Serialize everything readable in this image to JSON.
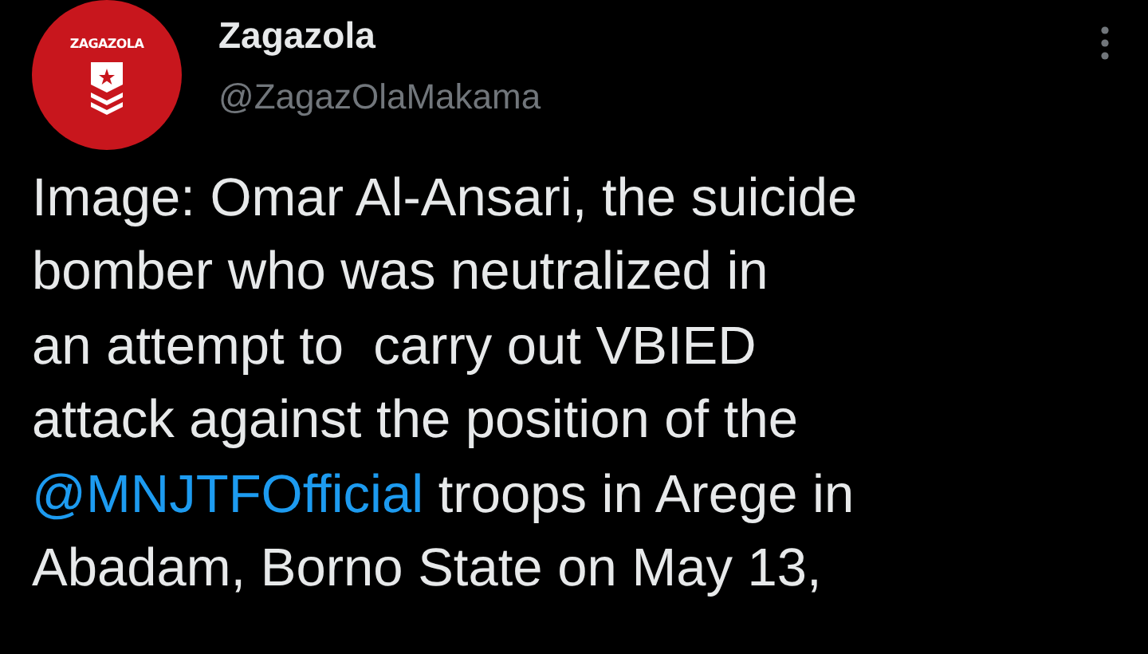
{
  "author": {
    "avatar_text": "ZAGAZOLA",
    "name": "Zagazola",
    "handle": "@ZagazOlaMakama"
  },
  "tweet": {
    "text_before": "Image: Omar Al-Ansari, the suicide\nbomber who was neutralized in\nan attempt to  carry out VBIED\nattack against the position of the\n",
    "mention": "@MNJTFOfficial",
    "text_after": " troops in Arege in\nAbadam, Borno State on May 13,"
  }
}
